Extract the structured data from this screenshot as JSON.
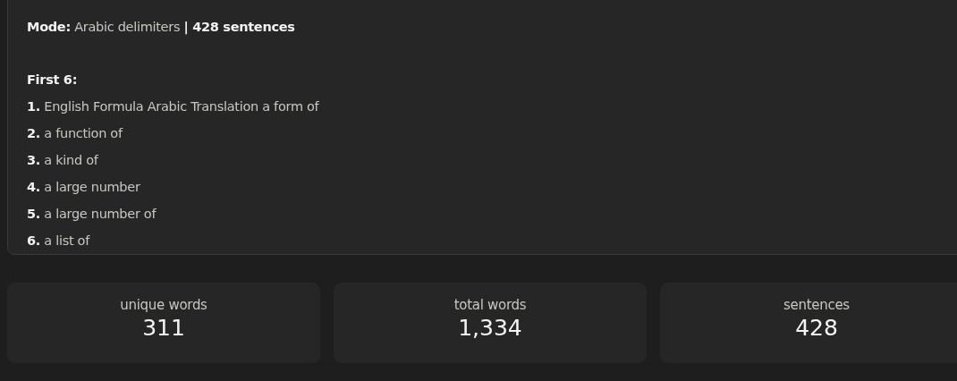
{
  "summary": {
    "mode_line": "**Mode:** Arabic delimiters **| 428 sentences**",
    "list_title": "First 6:",
    "items": [
      "**1.** English Formula Arabic Translation a form of",
      "**2.** a function of",
      "**3.** a kind of",
      "**4.** a large number",
      "**5.** a large number of",
      "**6.** a list of"
    ]
  },
  "stats": [
    {
      "label": "unique words",
      "value": "311"
    },
    {
      "label": "total words",
      "value": "1,334"
    },
    {
      "label": "sentences",
      "value": "428"
    }
  ]
}
